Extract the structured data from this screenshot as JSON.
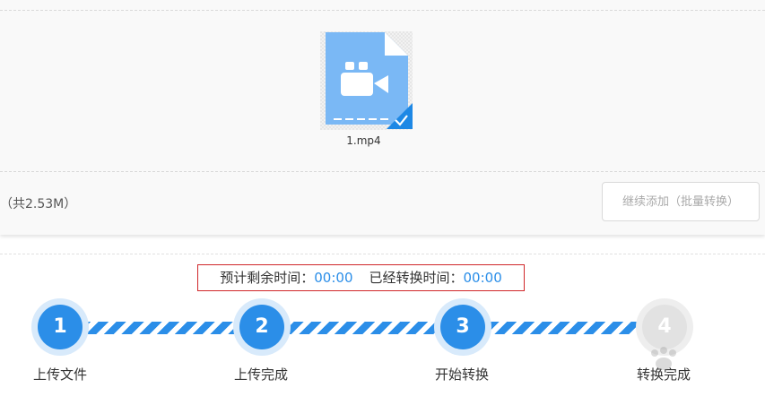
{
  "file": {
    "name": "1.mp4"
  },
  "summary": {
    "size_text": "（共2.53M）"
  },
  "actions": {
    "add_label": "继续添加（批量转换）"
  },
  "timing": {
    "remaining_label": "预计剩余时间：",
    "remaining_value": "00:00",
    "elapsed_label": "已经转换时间：",
    "elapsed_value": "00:00"
  },
  "steps": [
    {
      "num": "1",
      "label": "上传文件"
    },
    {
      "num": "2",
      "label": "上传完成"
    },
    {
      "num": "3",
      "label": "开始转换"
    },
    {
      "num": "4",
      "label": "转换完成"
    }
  ],
  "colors": {
    "accent": "#2b8ee8",
    "file_icon": "#7ab8f5",
    "highlight_border": "#d0272a"
  }
}
